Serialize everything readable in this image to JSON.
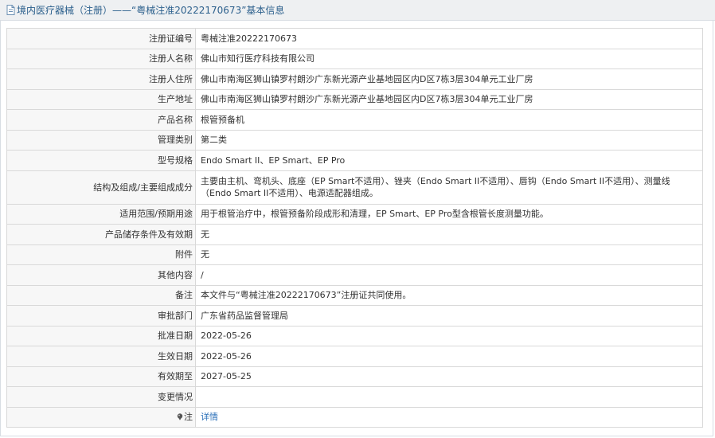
{
  "header": {
    "title": "境内医疗器械（注册）——“粤械注准20222170673”基本信息"
  },
  "rows": [
    {
      "label": "注册证编号",
      "value": "粤械注准20222170673"
    },
    {
      "label": "注册人名称",
      "value": "佛山市知行医疗科技有限公司"
    },
    {
      "label": "注册人住所",
      "value": "佛山市南海区狮山镇罗村朗沙广东新光源产业基地园区内D区7栋3层304单元工业厂房"
    },
    {
      "label": "生产地址",
      "value": "佛山市南海区狮山镇罗村朗沙广东新光源产业基地园区内D区7栋3层304单元工业厂房"
    },
    {
      "label": "产品名称",
      "value": "根管预备机"
    },
    {
      "label": "管理类别",
      "value": "第二类"
    },
    {
      "label": "型号规格",
      "value": "Endo Smart II、EP Smart、EP Pro"
    },
    {
      "label": "结构及组成/主要组成成分",
      "value": "主要由主机、弯机头、底座（EP Smart不适用）、锉夹（Endo Smart II不适用）、唇钩（Endo Smart II不适用）、测量线（Endo Smart II不适用）、电源适配器组成。"
    },
    {
      "label": "适用范围/预期用途",
      "value": "用于根管治疗中，根管预备阶段成形和清理，EP Smart、EP Pro型含根管长度测量功能。"
    },
    {
      "label": "产品储存条件及有效期",
      "value": "无"
    },
    {
      "label": "附件",
      "value": "无"
    },
    {
      "label": "其他内容",
      "value": "/"
    },
    {
      "label": "备注",
      "value": "本文件与“粤械注准20222170673”注册证共同使用。"
    },
    {
      "label": "审批部门",
      "value": "广东省药品监督管理局"
    },
    {
      "label": "批准日期",
      "value": "2022-05-26"
    },
    {
      "label": "生效日期",
      "value": "2022-05-26"
    },
    {
      "label": "有效期至",
      "value": "2027-05-25"
    },
    {
      "label": "变更情况",
      "value": ""
    }
  ],
  "note_row": {
    "label": "注",
    "link_text": "详情"
  },
  "icons": {
    "title_icon": "document-icon",
    "note_icon": "pin-icon"
  },
  "colors": {
    "title_text": "#2b5f8c",
    "link": "#2a6fb8",
    "label_bg": "#f7f7f7",
    "border": "#d9d9d9"
  }
}
